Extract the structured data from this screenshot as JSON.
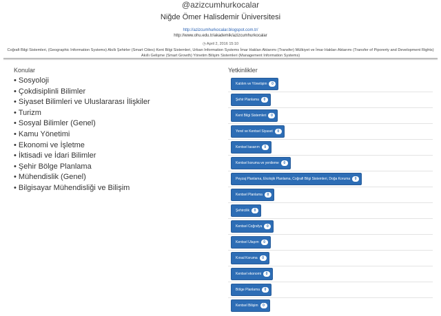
{
  "header": {
    "handle": "@azizcumhurkocalar",
    "university": "Niğde Ömer Halisdemir Üniversitesi",
    "link_blog": "http://azizcumhurkocalar.blogspot.com.tr/",
    "link_academic": "http://www.ohu.edu.tr/akademik/azizcumhurkocalar",
    "date": "April 2, 2016 15:10",
    "date_icon": "clock-icon",
    "description": "Coğrafi Bilgi Sistemleri, (Geographic Information Systems) Akıllı Şehirler (Smart Cities) Kent Bilgi Sistemleri, Urban Information Systems İmar Hakları Aktarımı (Transfer) Mülkiyet ve İmar Hakları Aktarımı (Transfer of Piporerty and Development Rights) Akıllı Gelişme (Smart Growth) Yönetim Bilişim Sistemleri (Management Information Systems)"
  },
  "topics": {
    "title": "Konular",
    "items": [
      "Sosyoloji",
      "Çokdisiplinli Bilimler",
      "Siyaset Bilimleri ve Uluslararası İlişkiler",
      "Turizm",
      "Sosyal Bilimler (Genel)",
      "Kamu Yönetimi",
      "Ekonomi ve İşletme",
      "İktisadi ve İdari Bilimler",
      "Şehir Bölge Planlama",
      "Mühendislik (Genel)",
      "Bilgisayar Mühendisliği ve Bilişim"
    ]
  },
  "skills": {
    "title": "Yetkinlikler",
    "items": [
      {
        "label": "Katılım ve Yönetişim",
        "count": "0"
      },
      {
        "label": "Şehir Planlama",
        "count": "0"
      },
      {
        "label": "Kent Bilgi Sistemleri",
        "count": "0"
      },
      {
        "label": "Yerel ve Kentsel Siyaset",
        "count": "0"
      },
      {
        "label": "Kentsel tasarım",
        "count": "0"
      },
      {
        "label": "Kentsel koruma ve yenileme",
        "count": "0"
      },
      {
        "label": "Peyzaj Planlama, Ekolojik Planlama, Coğrafi Bilgi Sistemleri, Doğa Koruma",
        "count": "0"
      },
      {
        "label": "Kentsel Planlama",
        "count": "0"
      },
      {
        "label": "Şehircilik",
        "count": "0"
      },
      {
        "label": "Kentsel Coğrafya",
        "count": "0"
      },
      {
        "label": "Kentsel Ulaşım",
        "count": "0"
      },
      {
        "label": "Kırsal Koruma",
        "count": "0"
      },
      {
        "label": "Kentsel ekonomi",
        "count": "0"
      },
      {
        "label": "Bölge Planlama",
        "count": "0"
      },
      {
        "label": "Kentsel Bilişim",
        "count": "0"
      }
    ]
  },
  "colors": {
    "button": "#2d6db5",
    "link": "#2a62b3"
  }
}
